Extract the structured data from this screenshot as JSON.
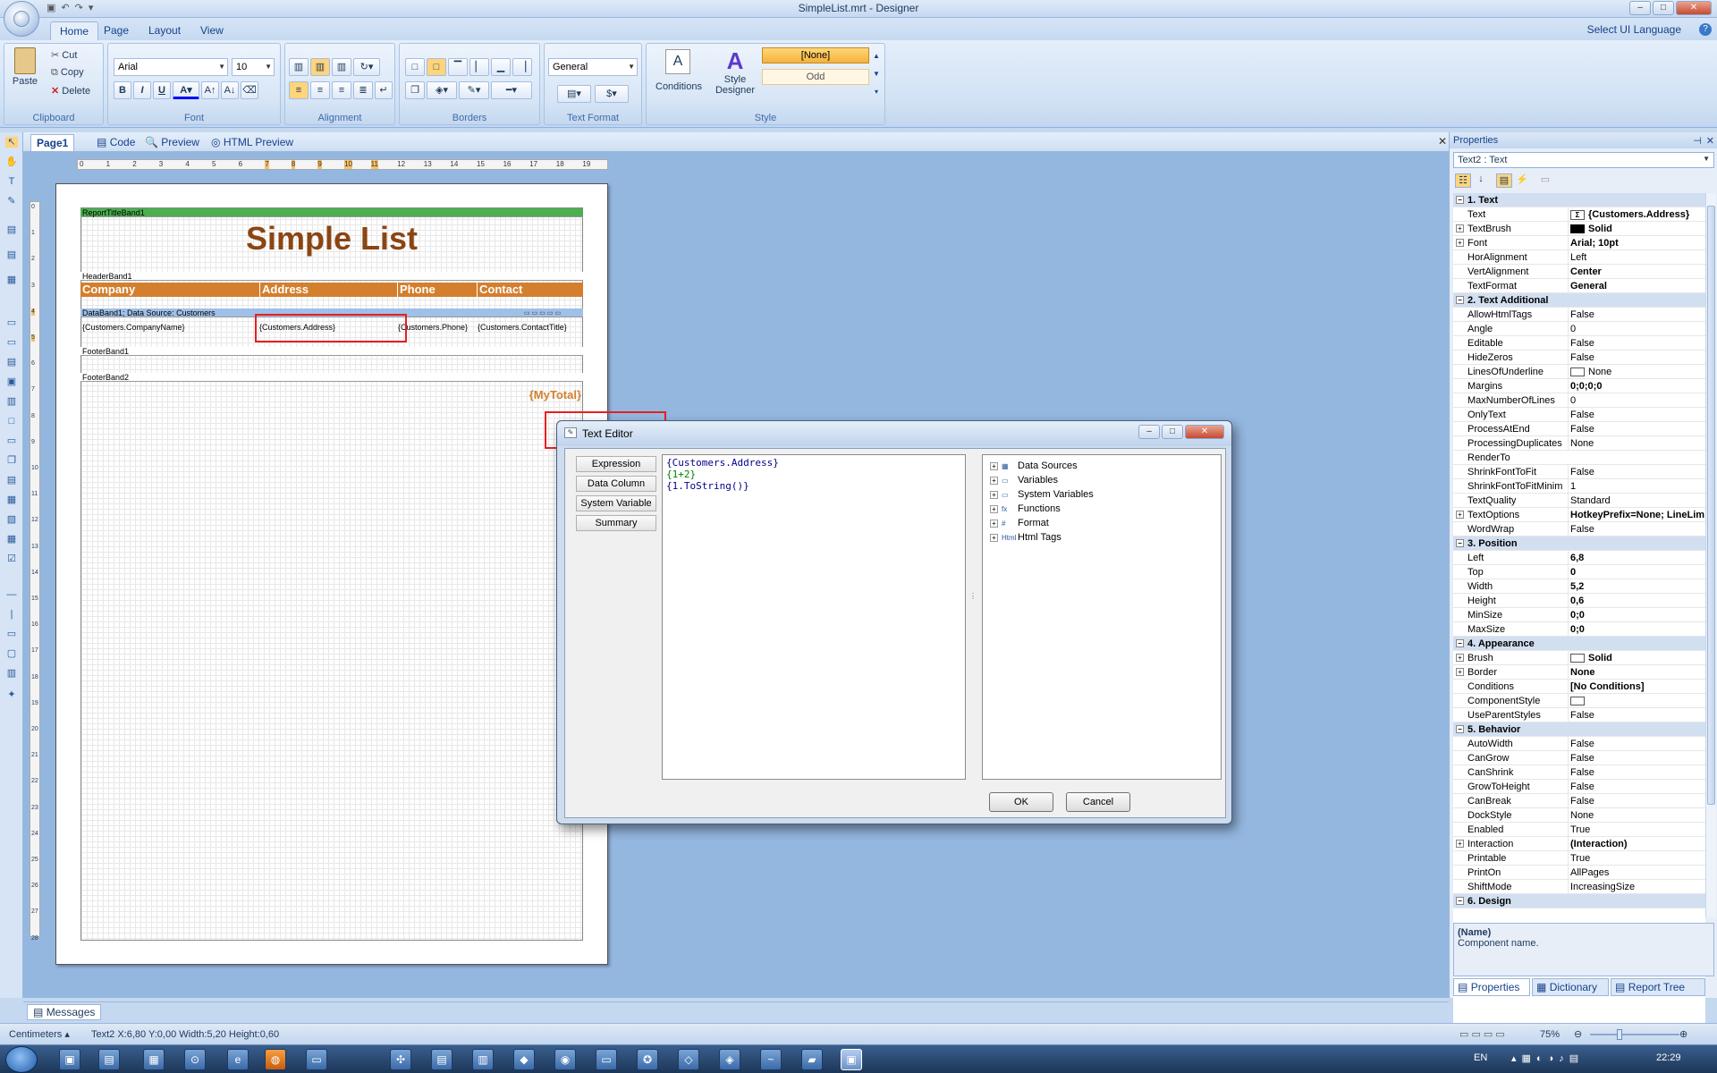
{
  "window": {
    "title": "SimpleList.mrt - Designer",
    "controls": {
      "minimize": "–",
      "maximize": "□",
      "close": "✕"
    }
  },
  "ribbon": {
    "tabs": [
      "Home",
      "Page",
      "Layout",
      "View"
    ],
    "active_tab": "Home",
    "language_selector": "Select UI Language",
    "groups": {
      "clipboard": {
        "label": "Clipboard",
        "paste": "Paste",
        "cut": "Cut",
        "copy": "Copy",
        "delete": "Delete"
      },
      "font": {
        "label": "Font",
        "family": "Arial",
        "size": "10"
      },
      "alignment": {
        "label": "Alignment"
      },
      "borders": {
        "label": "Borders"
      },
      "text_format": {
        "label": "Text Format",
        "format": "General"
      },
      "style": {
        "label": "Style",
        "conditions": "Conditions",
        "style_designer_line1": "Style",
        "style_designer_line2": "Designer",
        "style_none": "[None]",
        "style_odd": "Odd"
      }
    }
  },
  "page_tabs": [
    "Page1",
    "Code",
    "Preview",
    "HTML Preview"
  ],
  "ruler_numbers": [
    "0",
    "1",
    "2",
    "3",
    "4",
    "5",
    "6",
    "7",
    "8",
    "9",
    "10",
    "11",
    "12",
    "13",
    "14",
    "15",
    "16",
    "17",
    "18",
    "19"
  ],
  "vruler_numbers": [
    "0",
    "1",
    "2",
    "3",
    "4",
    "5",
    "6",
    "7",
    "8",
    "9",
    "10",
    "11",
    "12",
    "13",
    "14",
    "15",
    "16",
    "17",
    "18",
    "19",
    "20",
    "21",
    "22",
    "23",
    "24",
    "25",
    "26",
    "27",
    "28"
  ],
  "report": {
    "report_title_band": "ReportTitleBand1",
    "title": "Simple List",
    "header_band": "HeaderBand1",
    "headers": [
      "Company",
      "Address",
      "Phone",
      "Contact"
    ],
    "data_band": "DataBand1; Data Source: Customers",
    "data_cells": [
      "{Customers.CompanyName}",
      "{Customers.Address}",
      "{Customers.Phone}",
      "{Customers.ContactTitle}"
    ],
    "footer_band1": "FooterBand1",
    "footer_band2": "FooterBand2",
    "total": "{MyTotal}"
  },
  "dialog": {
    "title": "Text Editor",
    "side_buttons": [
      "Expression",
      "Data Column",
      "System Variable",
      "Summary"
    ],
    "editor_lines": [
      "{Customers.Address}",
      "{1+2}",
      "{1.ToString()}"
    ],
    "tree": [
      "Data Sources",
      "Variables",
      "System Variables",
      "Functions",
      "Format",
      "Html Tags"
    ],
    "tree_icons": [
      "table-icon",
      "variables-icon",
      "system-variables-icon",
      "fx-icon",
      "format-icon",
      "html-icon"
    ],
    "tree_icon_glyphs": [
      "▦",
      "▭",
      "▭",
      "fx",
      "#",
      "Html"
    ],
    "ok": "OK",
    "cancel": "Cancel"
  },
  "properties": {
    "panel_title": "Properties",
    "object": "Text2 : Text",
    "rows": [
      {
        "cat": true,
        "name": "1. Text",
        "value": ""
      },
      {
        "name": "Text",
        "value": "{Customers.Address}",
        "bold": true
      },
      {
        "name": "TextBrush",
        "value": "Solid",
        "bold": true,
        "exp": true
      },
      {
        "name": "Font",
        "value": "Arial; 10pt",
        "bold": true,
        "exp": true
      },
      {
        "name": "HorAlignment",
        "value": "Left"
      },
      {
        "name": "VertAlignment",
        "value": "Center",
        "bold": true
      },
      {
        "name": "TextFormat",
        "value": "General",
        "bold": true
      },
      {
        "cat": true,
        "name": "2. Text Additional",
        "value": ""
      },
      {
        "name": "AllowHtmlTags",
        "value": "False"
      },
      {
        "name": "Angle",
        "value": "0"
      },
      {
        "name": "Editable",
        "value": "False"
      },
      {
        "name": "HideZeros",
        "value": "False"
      },
      {
        "name": "LinesOfUnderline",
        "value": "None"
      },
      {
        "name": "Margins",
        "value": "0;0;0;0",
        "bold": true
      },
      {
        "name": "MaxNumberOfLines",
        "value": "0"
      },
      {
        "name": "OnlyText",
        "value": "False"
      },
      {
        "name": "ProcessAtEnd",
        "value": "False"
      },
      {
        "name": "ProcessingDuplicates",
        "value": "None"
      },
      {
        "name": "RenderTo",
        "value": ""
      },
      {
        "name": "ShrinkFontToFit",
        "value": "False"
      },
      {
        "name": "ShrinkFontToFitMinimu",
        "value": "1"
      },
      {
        "name": "TextQuality",
        "value": "Standard"
      },
      {
        "name": "TextOptions",
        "value": "HotkeyPrefix=None; LineLim",
        "bold": true,
        "exp": true
      },
      {
        "name": "WordWrap",
        "value": "False"
      },
      {
        "cat": true,
        "name": "3. Position",
        "value": ""
      },
      {
        "name": "Left",
        "value": "6,8",
        "bold": true
      },
      {
        "name": "Top",
        "value": "0",
        "bold": true
      },
      {
        "name": "Width",
        "value": "5,2",
        "bold": true
      },
      {
        "name": "Height",
        "value": "0,6",
        "bold": true
      },
      {
        "name": "MinSize",
        "value": "0;0",
        "bold": true
      },
      {
        "name": "MaxSize",
        "value": "0;0",
        "bold": true
      },
      {
        "cat": true,
        "name": "4. Appearance",
        "value": ""
      },
      {
        "name": "Brush",
        "value": "Solid",
        "bold": true,
        "exp": true
      },
      {
        "name": "Border",
        "value": "None",
        "bold": true,
        "exp": true
      },
      {
        "name": "Conditions",
        "value": "[No Conditions]",
        "bold": true
      },
      {
        "name": "ComponentStyle",
        "value": ""
      },
      {
        "name": "UseParentStyles",
        "value": "False"
      },
      {
        "cat": true,
        "name": "5. Behavior",
        "value": ""
      },
      {
        "name": "AutoWidth",
        "value": "False"
      },
      {
        "name": "CanGrow",
        "value": "False"
      },
      {
        "name": "CanShrink",
        "value": "False"
      },
      {
        "name": "GrowToHeight",
        "value": "False"
      },
      {
        "name": "CanBreak",
        "value": "False"
      },
      {
        "name": "DockStyle",
        "value": "None"
      },
      {
        "name": "Enabled",
        "value": "True"
      },
      {
        "name": "Interaction",
        "value": "(Interaction)",
        "bold": true,
        "exp": true
      },
      {
        "name": "Printable",
        "value": "True"
      },
      {
        "name": "PrintOn",
        "value": "AllPages"
      },
      {
        "name": "ShiftMode",
        "value": "IncreasingSize"
      },
      {
        "cat": true,
        "name": "6. Design",
        "value": ""
      }
    ],
    "desc_title": "(Name)",
    "desc_text": "Component name.",
    "bottom_tabs": [
      "Properties",
      "Dictionary",
      "Report Tree"
    ]
  },
  "messages_tab": "Messages",
  "status": {
    "units": "Centimeters",
    "info": "Text2   X:6,80  Y:0,00  Width:5,20  Height:0,60",
    "zoom": "75%"
  },
  "taskbar": {
    "lang": "EN",
    "time": "22:29",
    "start_icon": "windows-start-icon"
  },
  "colors": {
    "header_band": "#d47f2e",
    "title": "#8b4513",
    "highlight": "#e32020",
    "data_band": "#9fc0e8",
    "report_title_band": "#4caf50"
  }
}
